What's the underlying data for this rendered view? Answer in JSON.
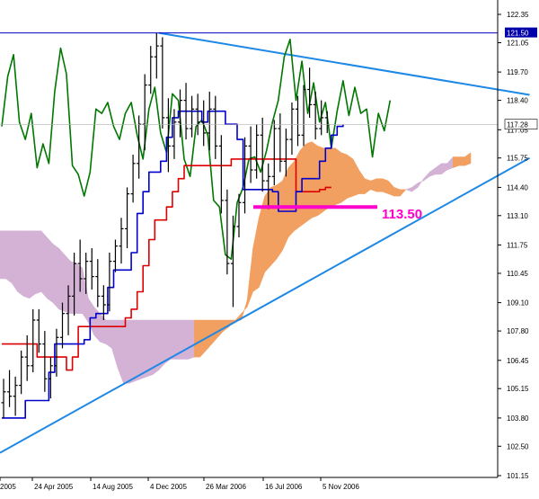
{
  "chart_data": {
    "type": "candlestick",
    "price_axis": {
      "ticks": [
        "122.35",
        "121.05",
        "119.70",
        "118.40",
        "117.05",
        "115.75",
        "114.40",
        "113.10",
        "111.75",
        "110.45",
        "109.10",
        "107.80",
        "106.45",
        "105.15",
        "103.80",
        "102.50",
        "101.15"
      ],
      "range": [
        100.9,
        122.9
      ]
    },
    "date_axis": {
      "ticks": [
        "2005",
        "24 Apr 2005",
        "14 Aug 2005",
        "4 Dec 2005",
        "26 Mar 2006",
        "16 Jul 2006",
        "5 Nov 2006"
      ]
    },
    "markers": {
      "resistance_level": {
        "value": 121.5,
        "label": "121.50"
      },
      "current_price": {
        "value": 117.28,
        "label": "117.28"
      },
      "support_level": {
        "value": 113.5,
        "label": "113.50"
      }
    },
    "trendlines": [
      {
        "name": "upper",
        "from": [
          27,
          121.5
        ],
        "to": [
          90,
          118.65
        ]
      },
      {
        "name": "lower",
        "from": [
          0,
          102.2
        ],
        "to": [
          90,
          115.75
        ]
      }
    ],
    "tenkan": [
      103.8,
      103.8,
      103.8,
      103.8,
      104.6,
      104.6,
      104.6,
      104.6,
      105.9,
      107.2,
      107.2,
      107.2,
      107.2,
      107.2,
      107.4,
      108.4,
      108.6,
      108.6,
      109.8,
      110.6,
      110.6,
      110.6,
      111.4,
      113.2,
      114.2,
      115.1,
      115.1,
      115.6,
      116.7,
      117.6,
      117.9,
      117.9,
      117.9,
      117.9,
      117.4,
      117.9,
      117.9,
      117.9,
      117.3,
      117.3,
      116.6,
      114.3,
      114.3,
      114.3,
      114.3,
      114.3,
      114.2,
      113.3,
      113.3,
      113.3,
      114.2,
      114.8,
      114.8,
      114.8,
      115.6,
      116.2,
      116.8,
      117.2,
      117.3
    ],
    "kijun": [
      107.2,
      107.2,
      107.2,
      107.2,
      107.2,
      107.2,
      106.6,
      106.6,
      106.6,
      106.6,
      106.6,
      106.0,
      106.6,
      108.0,
      108.0,
      108.0,
      108.0,
      108.0,
      108.0,
      108.0,
      108.0,
      108.4,
      108.8,
      109.6,
      110.8,
      112.0,
      112.9,
      112.9,
      113.5,
      114.2,
      114.8,
      115.4,
      115.4,
      115.4,
      115.4,
      115.4,
      115.4,
      115.4,
      115.4,
      115.7,
      115.7,
      115.7,
      115.7,
      115.7,
      115.7,
      115.7,
      115.7,
      115.7,
      115.7,
      115.7,
      114.2,
      114.2,
      114.2,
      114.2,
      114.3,
      114.4,
      114.4
    ],
    "chikou": [
      117.2,
      119.5,
      120.5,
      117.4,
      116.6,
      117.8,
      115.3,
      116.4,
      115.5,
      118.8,
      120.8,
      119.6,
      115.4,
      115.0,
      114.0,
      115.1,
      118.0,
      117.8,
      118.3,
      117.2,
      116.6,
      117.8,
      118.3,
      116.8,
      115.7,
      118.0,
      119.0,
      116.9,
      116.0,
      118.7,
      118.4,
      115.7,
      114.9,
      117.2,
      117.5,
      116.8,
      113.8,
      113.5,
      111.3,
      111.1,
      113.7,
      114.4,
      115.7,
      115.8,
      115.1,
      116.1,
      117.4,
      118.4,
      120.4,
      121.2,
      118.4,
      120.2,
      117.8,
      119.2,
      117.4,
      118.3,
      116.2,
      117.9,
      119.3,
      117.7,
      119.0,
      117.8,
      118.0,
      115.8,
      117.8,
      117.0,
      118.4
    ],
    "cloud_top": [
      112.4,
      112.4,
      112.4,
      112.4,
      112.4,
      112.4,
      112.4,
      112.4,
      112.1,
      111.8,
      111.6,
      111.3,
      111.0,
      110.9,
      110.7,
      109.3,
      108.9,
      108.6,
      108.3,
      108.3,
      108.3,
      108.3,
      108.3,
      108.3,
      108.3,
      108.3,
      108.3,
      108.3,
      108.3,
      108.3,
      108.3,
      108.3,
      108.3,
      108.3,
      108.3,
      108.3,
      108.3,
      108.3,
      108.3,
      108.3,
      108.3,
      108.3,
      109.2,
      111.6,
      113.0,
      114.0,
      114.4,
      114.5,
      114.7,
      115.3,
      115.6,
      116.1,
      116.4,
      116.5,
      116.3,
      116.2,
      116.2,
      116.2,
      116.0,
      115.9,
      115.7,
      115.2,
      114.8,
      114.7,
      114.8,
      114.8,
      114.7,
      114.4,
      114.3,
      114.3,
      114.2,
      114.4,
      114.8,
      115.1,
      115.3,
      115.5,
      115.5,
      115.8,
      115.8,
      115.8,
      116.0
    ],
    "cloud_bottom": [
      110.2,
      110.2,
      110.0,
      109.6,
      109.4,
      109.3,
      109.5,
      109.6,
      109.3,
      109.1,
      108.8,
      108.7,
      108.6,
      108.6,
      108.6,
      108.2,
      107.6,
      107.3,
      107.2,
      107.0,
      106.1,
      105.4,
      105.4,
      105.5,
      105.6,
      105.7,
      105.8,
      106.0,
      106.3,
      106.5,
      106.5,
      106.5,
      106.5,
      106.6,
      106.6,
      106.9,
      107.2,
      107.5,
      107.8,
      108.0,
      108.3,
      108.6,
      108.9,
      109.6,
      109.8,
      110.5,
      110.8,
      111.1,
      111.5,
      112.1,
      112.4,
      112.6,
      112.8,
      113.0,
      113.1,
      113.3,
      113.5,
      113.6,
      113.7,
      113.9,
      114.0,
      114.1,
      114.1,
      114.3,
      114.2,
      114.2,
      114.1,
      114.0,
      114.0,
      114.3,
      114.4,
      114.6,
      114.7,
      114.9,
      115.0,
      115.0,
      115.2,
      115.3,
      115.4,
      115.4,
      115.5
    ],
    "candles": [
      [
        104.5,
        105.6,
        103.8,
        105.0
      ],
      [
        105.0,
        106.0,
        104.3,
        104.8
      ],
      [
        104.8,
        105.7,
        103.9,
        105.3
      ],
      [
        105.3,
        106.9,
        104.9,
        106.6
      ],
      [
        106.6,
        107.6,
        105.5,
        106.2
      ],
      [
        106.2,
        108.8,
        105.9,
        108.3
      ],
      [
        108.3,
        108.8,
        106.8,
        107.2
      ],
      [
        107.2,
        107.8,
        105.0,
        105.6
      ],
      [
        105.6,
        106.6,
        104.7,
        106.2
      ],
      [
        106.2,
        107.9,
        105.7,
        107.5
      ],
      [
        107.5,
        109.1,
        107.0,
        108.6
      ],
      [
        108.6,
        109.9,
        107.6,
        109.4
      ],
      [
        109.4,
        111.4,
        108.5,
        110.9
      ],
      [
        110.9,
        112.0,
        109.6,
        110.2
      ],
      [
        110.2,
        111.4,
        109.5,
        111.0
      ],
      [
        111.0,
        111.6,
        109.7,
        110.3
      ],
      [
        110.3,
        111.1,
        108.9,
        109.4
      ],
      [
        109.4,
        109.9,
        108.3,
        109.0
      ],
      [
        109.0,
        111.4,
        108.7,
        111.0
      ],
      [
        111.0,
        112.0,
        110.5,
        111.7
      ],
      [
        111.7,
        113.0,
        110.9,
        112.5
      ],
      [
        112.5,
        114.4,
        111.6,
        114.1
      ],
      [
        114.1,
        115.9,
        113.7,
        115.5
      ],
      [
        115.5,
        117.7,
        114.8,
        117.3
      ],
      [
        117.3,
        119.6,
        116.1,
        119.1
      ],
      [
        119.1,
        120.9,
        118.7,
        120.4
      ],
      [
        120.4,
        121.5,
        119.4,
        120.9
      ],
      [
        120.9,
        121.3,
        117.1,
        117.6
      ],
      [
        117.6,
        118.5,
        115.1,
        116.3
      ],
      [
        116.3,
        118.0,
        115.7,
        117.4
      ],
      [
        117.4,
        118.9,
        116.7,
        118.4
      ],
      [
        118.4,
        119.2,
        116.6,
        117.1
      ],
      [
        117.1,
        118.6,
        116.7,
        118.0
      ],
      [
        118.0,
        118.7,
        116.8,
        117.4
      ],
      [
        117.4,
        118.4,
        116.3,
        116.9
      ],
      [
        116.9,
        118.8,
        116.1,
        118.0
      ],
      [
        118.0,
        118.6,
        115.7,
        116.3
      ],
      [
        116.3,
        116.8,
        113.2,
        113.8
      ],
      [
        113.8,
        114.3,
        110.4,
        110.9
      ],
      [
        110.9,
        113.1,
        108.9,
        112.6
      ],
      [
        112.6,
        114.1,
        112.1,
        113.7
      ],
      [
        113.7,
        116.7,
        113.2,
        116.3
      ],
      [
        116.3,
        117.2,
        114.6,
        115.2
      ],
      [
        115.2,
        117.3,
        114.8,
        116.8
      ],
      [
        116.8,
        117.6,
        114.2,
        114.7
      ],
      [
        114.7,
        115.5,
        113.4,
        114.9
      ],
      [
        114.9,
        117.5,
        114.5,
        117.1
      ],
      [
        117.1,
        117.8,
        115.1,
        115.6
      ],
      [
        115.6,
        117.1,
        114.9,
        116.6
      ],
      [
        116.6,
        118.3,
        115.9,
        118.0
      ],
      [
        118.0,
        118.6,
        116.3,
        116.8
      ],
      [
        116.8,
        119.1,
        116.3,
        118.9
      ],
      [
        118.9,
        119.9,
        117.6,
        118.2
      ],
      [
        118.2,
        118.8,
        116.6,
        117.1
      ],
      [
        117.1,
        118.4,
        116.8,
        117.6
      ],
      [
        117.6,
        117.9,
        116.9,
        117.28
      ]
    ]
  }
}
